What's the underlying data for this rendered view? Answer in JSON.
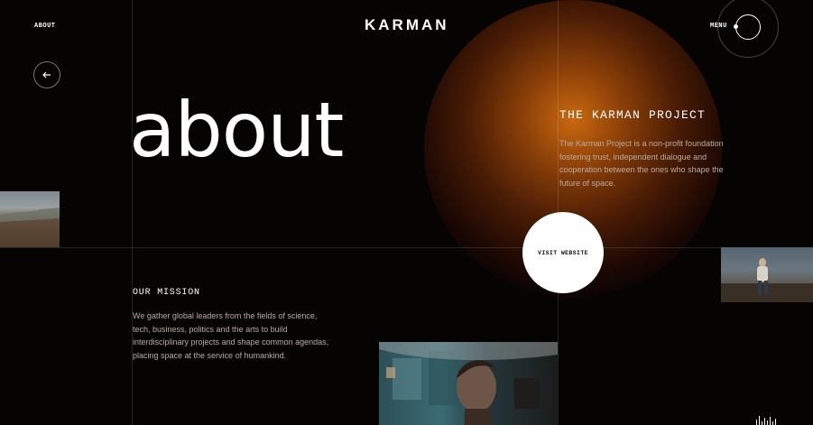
{
  "header": {
    "nav_about": "ABOUT",
    "brand": "KARMAN",
    "menu_label": "MENU"
  },
  "hero": {
    "title": "about"
  },
  "project": {
    "title": "THE KARMAN PROJECT",
    "description": "The Karman Project is a non-profit foundation fostering trust, independent dialogue and cooperation between the ones who shape the future of space.",
    "cta": "VISIT WEBSITE"
  },
  "mission": {
    "title": "OUR MISSION",
    "description": "We gather global leaders from the fields of science, tech, business, politics and the arts to build interdisciplinary projects and shape common agendas, placing space at the service of humankind."
  },
  "icons": {
    "back": "arrow-left-icon",
    "menu": "menu-ring-icon",
    "sound": "sound-wave-icon"
  },
  "colors": {
    "background": "#060303",
    "glow": "#c9690f",
    "text_muted": "#b8aca3"
  }
}
